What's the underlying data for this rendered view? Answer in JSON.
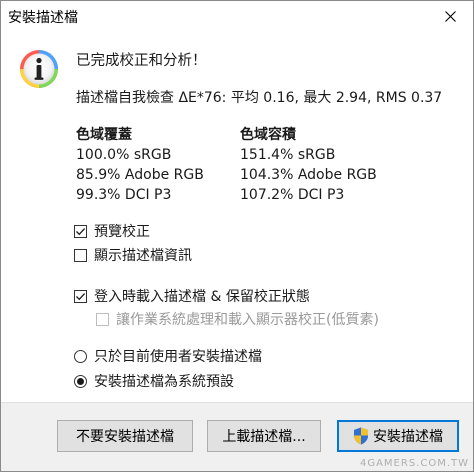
{
  "window": {
    "title": "安裝描述檔"
  },
  "message": {
    "headline": "已完成校正和分析！",
    "profile_check": "描述檔自我檢查 ΔE*76: 平均 0.16, 最大 2.94, RMS 0.37"
  },
  "gamut_coverage": {
    "heading": "色域覆蓋",
    "rows": [
      "100.0% sRGB",
      "85.9% Adobe RGB",
      "99.3% DCI P3"
    ]
  },
  "gamut_volume": {
    "heading": "色域容積",
    "rows": [
      "151.4% sRGB",
      "104.3% Adobe RGB",
      "107.2% DCI P3"
    ]
  },
  "options": {
    "preview_calibration": {
      "label": "預覽校正",
      "checked": true
    },
    "show_profile_info": {
      "label": "顯示描述檔資訊",
      "checked": false
    },
    "install_on_login": {
      "label": "登入時載入描述檔 & 保留校正狀態",
      "checked": true
    },
    "let_os_handle": {
      "label": "讓作業系統處理和載入顯示器校正(低質素)",
      "checked": false,
      "disabled": true
    },
    "install_current_user": {
      "label": "只於目前使用者安裝描述檔",
      "selected": false
    },
    "install_system_default": {
      "label": "安裝描述檔為系統預設",
      "selected": true
    }
  },
  "buttons": {
    "dont_install": "不要安裝描述檔",
    "upload": "上載描述檔...",
    "install": "安裝描述檔"
  },
  "watermark": "4GAMERS.COM.TW",
  "colors": {
    "accent": "#0078d7",
    "footer_bg": "#f0f0f0"
  }
}
